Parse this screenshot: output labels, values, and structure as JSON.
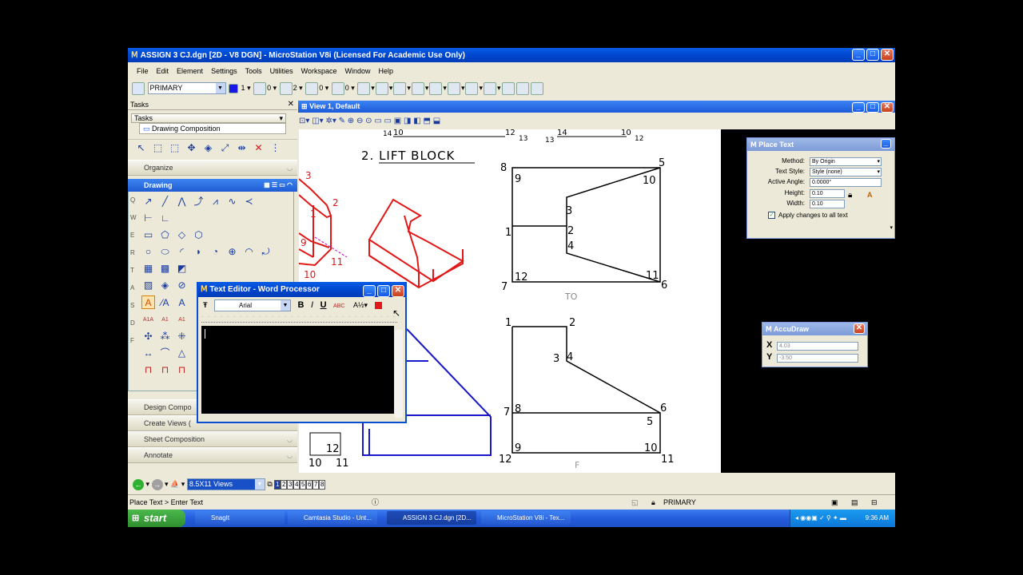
{
  "app": {
    "title": "ASSIGN 3 CJ.dgn [2D - V8 DGN] - MicroStation V8i (Licensed For Academic Use Only)"
  },
  "menu": [
    "File",
    "Edit",
    "Element",
    "Settings",
    "Tools",
    "Utilities",
    "Workspace",
    "Window",
    "Help"
  ],
  "attrs": {
    "level": "PRIMARY",
    "color": "1",
    "style": "0",
    "weight": "2",
    "trans": "0",
    "prio": "0"
  },
  "tasks": {
    "header": "Tasks",
    "dropdown": "Tasks",
    "selected": "Drawing Composition",
    "sections": {
      "organize": "Organize",
      "drawing": "Drawing",
      "design": "Design Compo",
      "create": "Create Views (",
      "sheet": "Sheet Composition",
      "annotate": "Annotate"
    },
    "row_letters": [
      "Q",
      "W",
      "E",
      "R",
      "T",
      "A",
      "S",
      "D",
      "F"
    ]
  },
  "view": {
    "title": "View 1, Default",
    "heading": "2. LIFT BLOCK"
  },
  "drawing_labels": {
    "top": [
      "14",
      "10",
      "12",
      "13",
      "13",
      "14",
      "10",
      "12"
    ],
    "iso": [
      "3",
      "2",
      "1",
      "9",
      "11",
      "10"
    ],
    "top_view": [
      "8",
      "5",
      "9",
      "10",
      "3",
      "2",
      "1",
      "4",
      "12",
      "11",
      "7",
      "6"
    ],
    "front_view": [
      "1",
      "2",
      "3",
      "4",
      "7",
      "8",
      "6",
      "5",
      "9",
      "10",
      "12",
      "11"
    ],
    "bottom_left": [
      "12",
      "10",
      "11"
    ],
    "hand_to": "TO",
    "hand_f": "F"
  },
  "place_text": {
    "title": "Place Text",
    "method_label": "Method:",
    "method": "By Origin",
    "style_label": "Text Style:",
    "style": "Style (none)",
    "angle_label": "Active Angle:",
    "angle": "0.0000°",
    "height_label": "Height:",
    "height": "0.10",
    "width_label": "Width:",
    "width": "0.10",
    "apply": "Apply changes to all text"
  },
  "accudraw": {
    "title": "AccuDraw",
    "x_label": "X",
    "x": "4.03",
    "y_label": "Y",
    "y": "-3.50"
  },
  "text_editor": {
    "title": "Text Editor - Word Processor",
    "font": "Arial",
    "bold": "B",
    "italic": "I",
    "underline": "U",
    "spell": "ABC"
  },
  "bottom": {
    "views_combo": "8.5X11 Views",
    "view_nums": [
      "1",
      "2",
      "3",
      "4",
      "5",
      "6",
      "7",
      "8"
    ]
  },
  "status": {
    "prompt": "Place Text > Enter Text",
    "level": "PRIMARY"
  },
  "taskbar": {
    "start": "start",
    "items": [
      "SnagIt",
      "Camtasia Studio - Unt...",
      "ASSIGN 3 CJ.dgn [2D...",
      "MicroStation V8i - Tex..."
    ],
    "clock": "9:36 AM"
  },
  "colors": {
    "red": "#e01818",
    "blue": "#1818c8",
    "xp_blue": "#0a5ee6"
  }
}
